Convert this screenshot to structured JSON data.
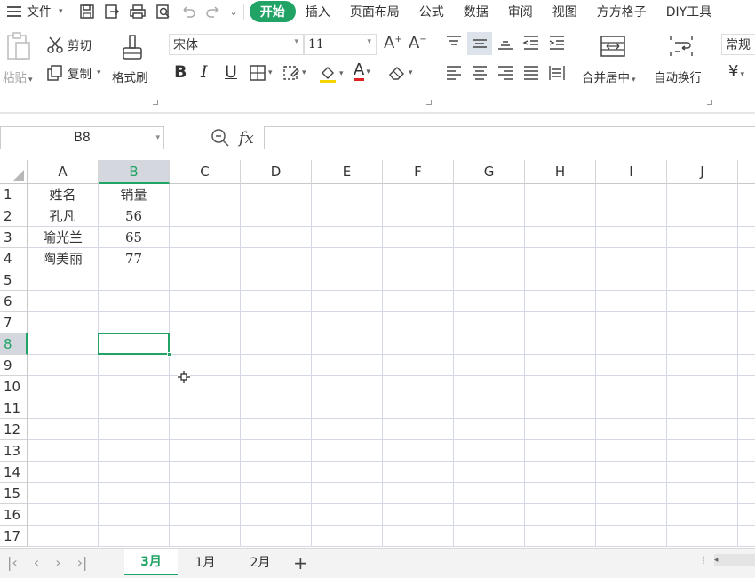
{
  "menubar": {
    "file_label": "文件",
    "tabs": [
      "开始",
      "插入",
      "页面布局",
      "公式",
      "数据",
      "审阅",
      "视图",
      "方方格子",
      "DIY工具"
    ],
    "active_tab": "开始"
  },
  "ribbon": {
    "paste_label": "粘贴",
    "cut_label": "剪切",
    "copy_label": "复制",
    "format_painter_label": "格式刷",
    "font_name": "宋体",
    "font_size": "11",
    "bold_label": "B",
    "italic_label": "I",
    "underline_label": "U",
    "font_color_label": "A",
    "merge_center_label": "合并居中",
    "wrap_text_label": "自动换行",
    "number_format": "常规",
    "currency_symbol": "¥"
  },
  "formula_bar": {
    "cell_ref": "B8",
    "fx_label": "fx",
    "value": ""
  },
  "grid": {
    "columns": [
      "A",
      "B",
      "C",
      "D",
      "E",
      "F",
      "G",
      "H",
      "I",
      "J"
    ],
    "rows": [
      "1",
      "2",
      "3",
      "4",
      "5",
      "6",
      "7",
      "8",
      "9",
      "10",
      "11",
      "12",
      "13",
      "14",
      "15",
      "16",
      "17"
    ],
    "selected_column": "B",
    "selected_row": "8",
    "cells": {
      "A1": "姓名",
      "B1": "销量",
      "A2": "孔凡",
      "B2": "56",
      "A3": "喻光兰",
      "B3": "65",
      "A4": "陶美丽",
      "B4": "77"
    }
  },
  "sheets": {
    "tabs": [
      "3月",
      "1月",
      "2月"
    ],
    "active": "3月",
    "add_label": "+"
  },
  "colors": {
    "accent": "#21a366",
    "header_sel_bg": "#d4d8de",
    "grid_line": "#d3d7e6"
  }
}
